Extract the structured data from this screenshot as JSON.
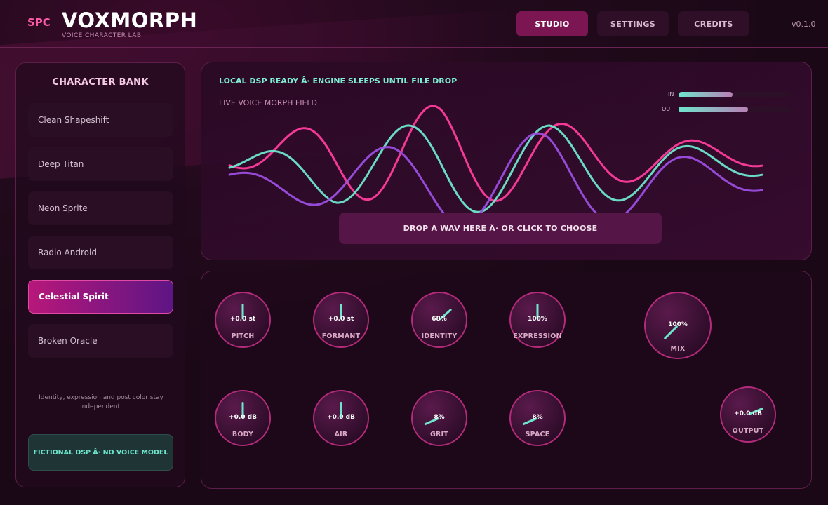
{
  "header": {
    "brand_tag": "SPC",
    "title": "VOXMORPH",
    "subtitle": "VOICE CHARACTER LAB",
    "nav": [
      {
        "label": "STUDIO",
        "active": true
      },
      {
        "label": "SETTINGS",
        "active": false
      },
      {
        "label": "CREDITS",
        "active": false
      }
    ],
    "version": "v0.1.0"
  },
  "sidebar": {
    "title": "CHARACTER BANK",
    "presets": [
      {
        "label": "Clean Shapeshift",
        "active": false
      },
      {
        "label": "Deep Titan",
        "active": false
      },
      {
        "label": "Neon Sprite",
        "active": false
      },
      {
        "label": "Radio Android",
        "active": false
      },
      {
        "label": "Celestial Spirit",
        "active": true
      },
      {
        "label": "Broken Oracle",
        "active": false
      }
    ],
    "note": "Identity, expression and post color stay independent.",
    "badge": "FICTIONAL DSP Â· NO VOICE MODEL"
  },
  "morph": {
    "status": "LOCAL DSP READY Â· ENGINE SLEEPS UNTIL FILE DROP",
    "field_label": "LIVE VOICE MORPH FIELD",
    "meters": [
      {
        "label": "IN",
        "level": 0.48
      },
      {
        "label": "OUT",
        "level": 0.62
      }
    ],
    "drop_label": "DROP A WAV HERE  Â·  OR CLICK TO CHOOSE",
    "wave_colors": [
      "#ff3c9c",
      "#6ee6cc",
      "#9b4fe0"
    ]
  },
  "knobs": [
    {
      "label": "PITCH",
      "value": "+0.0 st",
      "level": 0.5
    },
    {
      "label": "FORMANT",
      "value": "+0.0 st",
      "level": 0.5
    },
    {
      "label": "IDENTITY",
      "value": "68%",
      "level": 0.68
    },
    {
      "label": "EXPRESSION",
      "value": "100%",
      "level": 0.5
    },
    {
      "label": "MIX",
      "value": "100%",
      "level": 0.0
    },
    {
      "label": "BODY",
      "value": "+0.0 dB",
      "level": 0.5
    },
    {
      "label": "AIR",
      "value": "+0.0 dB",
      "level": 0.5
    },
    {
      "label": "GRIT",
      "value": "8%",
      "level": 0.08
    },
    {
      "label": "SPACE",
      "value": "8%",
      "level": 0.08
    },
    {
      "label": "OUTPUT",
      "value": "+0.0 dB",
      "level": 0.75
    }
  ],
  "colors": {
    "accent_pink": "#ff5aa8",
    "accent_teal": "#6ee6cc",
    "accent_purple": "#9b4fe0"
  }
}
